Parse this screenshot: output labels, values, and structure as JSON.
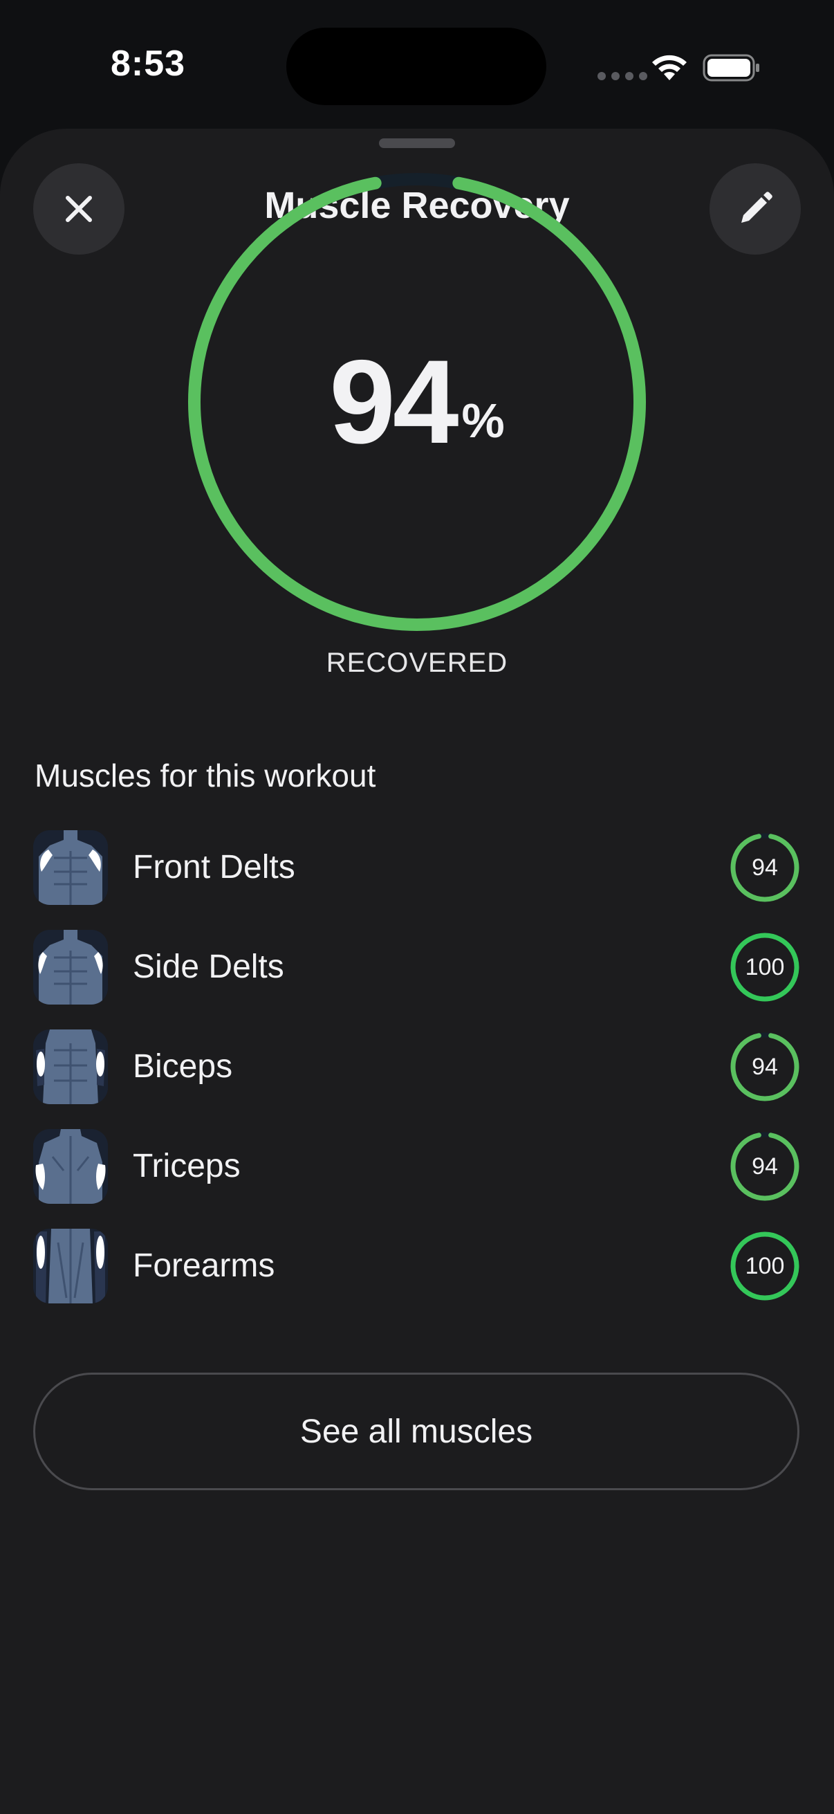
{
  "status_bar": {
    "time": "8:53",
    "icons": [
      "cellular-icon",
      "wifi-icon",
      "battery-icon"
    ]
  },
  "sheet": {
    "title": "Muscle Recovery",
    "close_icon": "close-icon",
    "edit_icon": "pencil-icon"
  },
  "recovery": {
    "value": "94",
    "unit": "%",
    "fraction": 0.94,
    "caption": "RECOVERED",
    "color": "#5ac05f"
  },
  "muscles": {
    "section_title": "Muscles for this workout",
    "items": [
      {
        "name": "Front Delts",
        "score": "94",
        "fraction": 0.94,
        "region": "front-delts"
      },
      {
        "name": "Side Delts",
        "score": "100",
        "fraction": 1.0,
        "region": "side-delts"
      },
      {
        "name": "Biceps",
        "score": "94",
        "fraction": 0.94,
        "region": "biceps"
      },
      {
        "name": "Triceps",
        "score": "94",
        "fraction": 0.94,
        "region": "triceps"
      },
      {
        "name": "Forearms",
        "score": "100",
        "fraction": 1.0,
        "region": "forearms"
      }
    ]
  },
  "see_all_label": "See all muscles",
  "colors": {
    "ring_green": "#5ac05f",
    "ring_full_green": "#34c759",
    "sheet_bg": "#1c1c1e",
    "track": "#15202a"
  }
}
